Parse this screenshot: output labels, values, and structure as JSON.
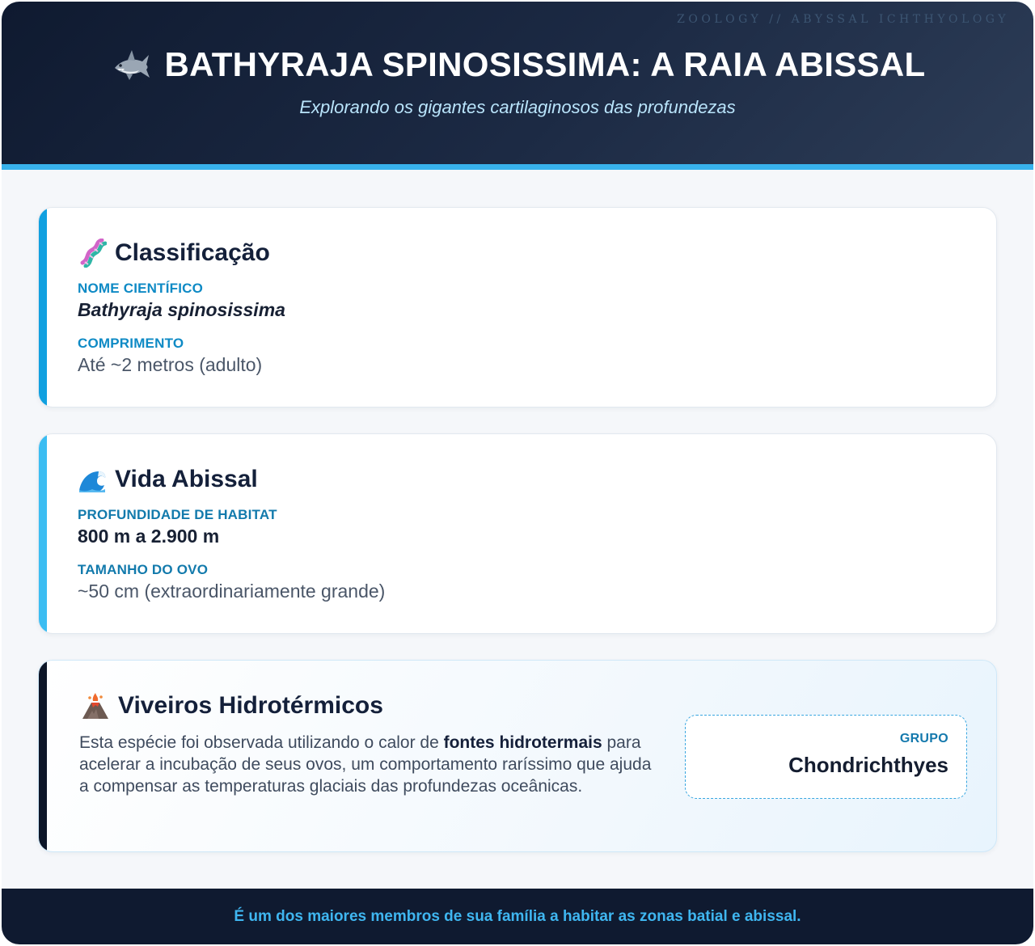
{
  "header": {
    "tagline": "ZOOLOGY // ABYSSAL ICHTHYOLOGY",
    "icon": "shark-icon",
    "title": "BATHYRAJA SPINOSISSIMA: A RAIA ABISSAL",
    "subtitle": "Explorando os gigantes cartilaginosos das profundezas"
  },
  "classification": {
    "icon": "dna-icon",
    "heading": "Classificação",
    "scientific_name_label": "NOME CIENTÍFICO",
    "scientific_name": "Bathyraja spinosissima",
    "length_label": "COMPRIMENTO",
    "length": "Até ~2 metros (adulto)"
  },
  "abyssal_life": {
    "icon": "wave-icon",
    "heading": "Vida Abissal",
    "depth_label": "PROFUNDIDADE DE HABITAT",
    "depth": "800 m a 2.900 m",
    "egg_size_label": "TAMANHO DO OVO",
    "egg_size": "~50 cm (extraordinariamente grande)"
  },
  "hydrothermal": {
    "icon": "volcano-icon",
    "heading": "Viveiros Hidrotérmicos",
    "desc_part1": "Esta espécie foi observada utilizando o calor de ",
    "desc_bold": "fontes hidrotermais",
    "desc_part2": " para acelerar a incubação de seus ovos, um comportamento raríssimo que ajuda a compensar as temperaturas glaciais das profundezas oceânicas.",
    "group_label": "GRUPO",
    "group_value": "Chondrichthyes"
  },
  "footer": {
    "text": "É um dos maiores membros de sua família a habitar as zonas batial e abissal."
  },
  "colors": {
    "header_bg": "#0f1a30",
    "accent": "#38b2ec",
    "label_blue": "#0e8ac5",
    "footer_text": "#3fb6f0"
  }
}
